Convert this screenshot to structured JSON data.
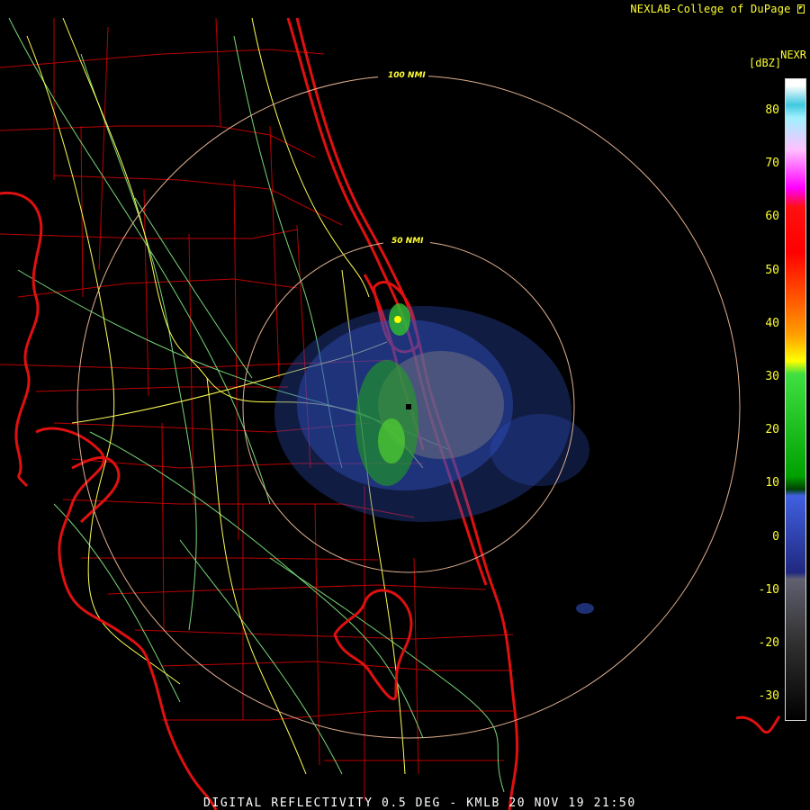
{
  "header": {
    "credit": "NEXLAB-College of DuPage",
    "credit_icon": "cursor-arrow-icon",
    "product": "NEXR",
    "unit": "[dBZ]"
  },
  "footer": {
    "caption": "DIGITAL REFLECTIVITY 0.5 DEG - KMLB 20 NOV 19 21:50"
  },
  "range_rings": [
    {
      "label": "100 NMI"
    },
    {
      "label": "50 NMI"
    }
  ],
  "colorbar": {
    "ticks": [
      "80",
      "70",
      "60",
      "50",
      "40",
      "30",
      "20",
      "10",
      "0",
      "-10",
      "-20",
      "-30"
    ],
    "stops": [
      {
        "color": "#ffffff"
      },
      {
        "color": "#00e0f0"
      },
      {
        "color": "#ff00ff"
      },
      {
        "color": "#ff0000"
      },
      {
        "color": "#ff8000"
      },
      {
        "color": "#ffff00"
      },
      {
        "color": "#00c000"
      },
      {
        "color": "#3050c0"
      },
      {
        "color": "#606070"
      }
    ]
  },
  "colors": {
    "coast": "#e01010",
    "counties": "#c00000",
    "highways": "#ffff66",
    "roads": "#80e080",
    "rings": "#e0b090"
  }
}
